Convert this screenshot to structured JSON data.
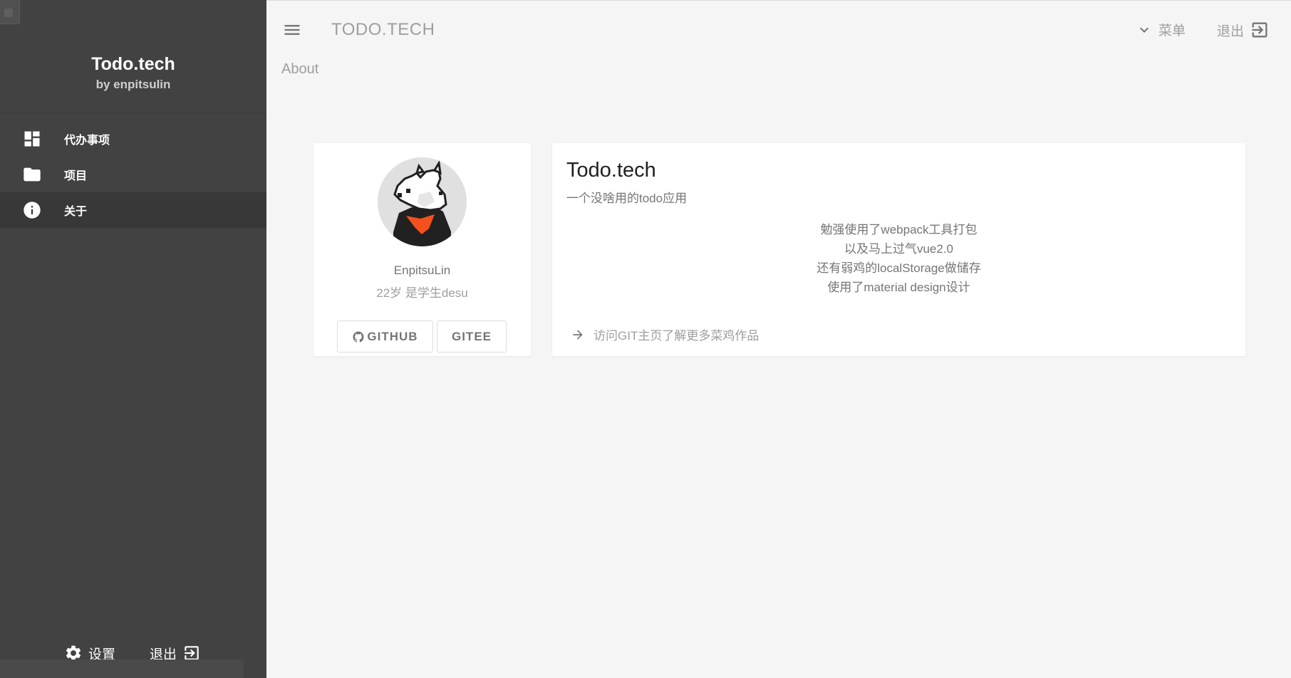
{
  "sidebar": {
    "brand_title": "Todo.tech",
    "brand_subtitle": "by enpitsulin",
    "items": [
      {
        "label": "代办事项",
        "icon": "dashboard-icon",
        "active": false
      },
      {
        "label": "项目",
        "icon": "folder-icon",
        "active": false
      },
      {
        "label": "关于",
        "icon": "info-icon",
        "active": true
      }
    ],
    "settings_label": "设置",
    "logout_label": "退出"
  },
  "topbar": {
    "title": "TODO.TECH",
    "menu_label": "菜单",
    "logout_label": "退出"
  },
  "breadcrumb": "About",
  "profile": {
    "name": "EnpitsuLin",
    "description": "22岁 是学生desu",
    "github_label": "GITHUB",
    "gitee_label": "GITEE"
  },
  "info": {
    "title": "Todo.tech",
    "subtitle": "一个没啥用的todo应用",
    "lines": [
      "勉强使用了webpack工具打包",
      "以及马上过气vue2.0",
      "还有弱鸡的localStorage做储存",
      "使用了material design设计"
    ],
    "link_label": "访问GIT主页了解更多菜鸡作品"
  },
  "colors": {
    "sidebar_bg": "#424242",
    "sidebar_active": "#383838",
    "page_bg": "#f5f5f5",
    "accent_avatar": "#f4511e"
  }
}
